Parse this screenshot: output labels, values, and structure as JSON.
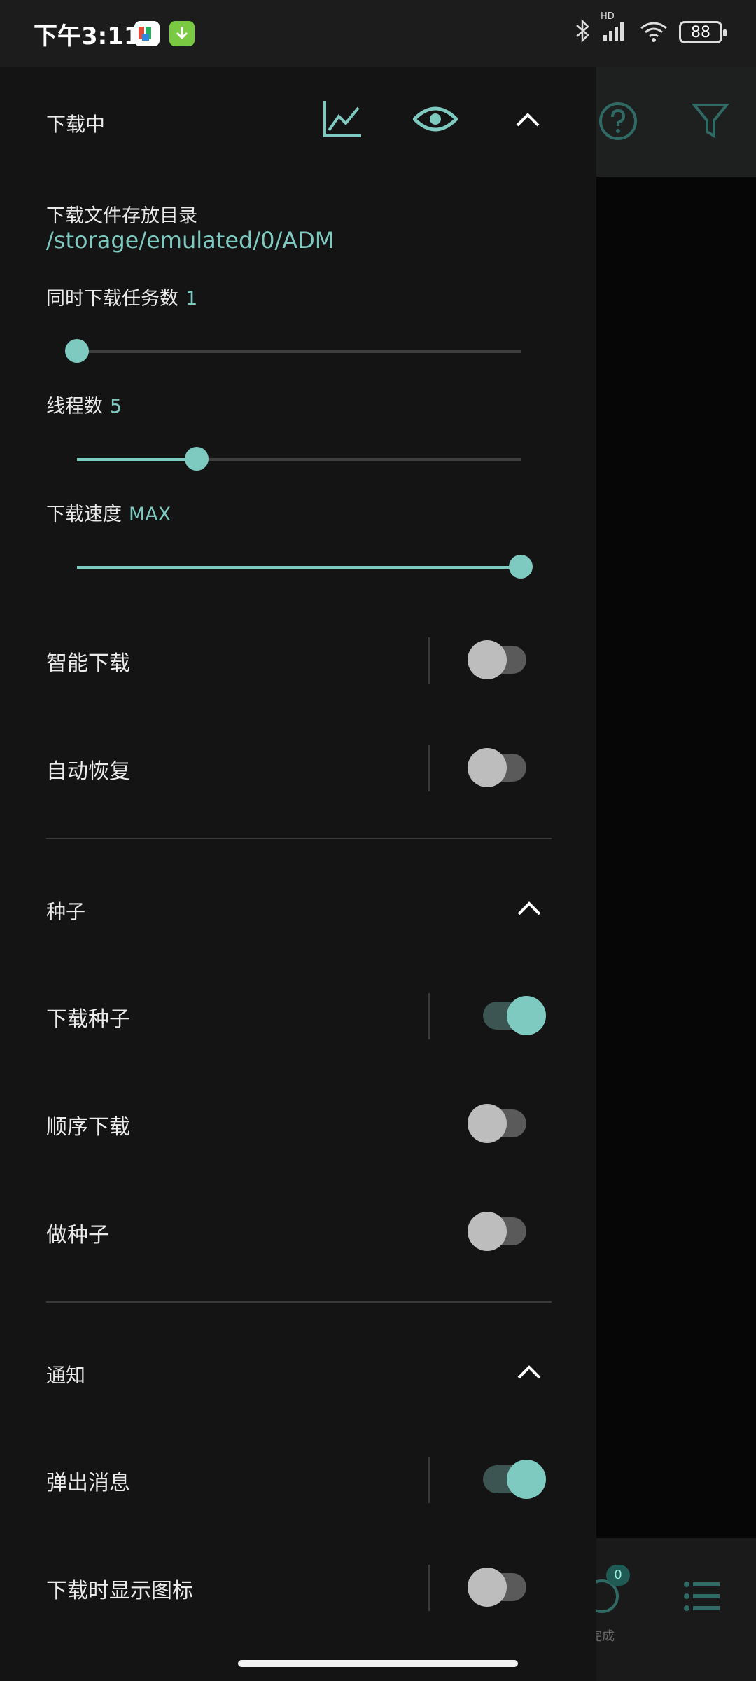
{
  "status_bar": {
    "time": "下午3:11",
    "icons": [
      "bluetooth-icon",
      "hd-signal-icon",
      "wifi-icon"
    ],
    "hd_label": "HD",
    "battery": "88"
  },
  "drawer": {
    "header": {
      "title": "下载中",
      "actions": [
        "chart-icon",
        "eye-icon",
        "chevron-up-icon"
      ]
    },
    "download_dir": {
      "label": "下载文件存放目录",
      "value": "/storage/emulated/0/ADM"
    },
    "concurrent_tasks": {
      "label": "同时下载任务数",
      "value": "1",
      "level": 0.0
    },
    "threads": {
      "label": "线程数",
      "value": "5",
      "level": 0.27
    },
    "speed": {
      "label": "下载速度",
      "value": "MAX",
      "level": 1.0
    },
    "toggles": [
      {
        "label": "智能下载",
        "on": false
      },
      {
        "label": "自动恢复",
        "on": false
      }
    ],
    "torrent_section": {
      "title": "种子",
      "items": [
        {
          "label": "下载种子",
          "on": true
        },
        {
          "label": "顺序下载",
          "on": false
        },
        {
          "label": "做种子",
          "on": false
        }
      ]
    },
    "notify_section": {
      "title": "通知",
      "items": [
        {
          "label": "弹出消息",
          "on": true
        },
        {
          "label": "下载时显示图标",
          "on": false
        }
      ]
    }
  },
  "background": {
    "toolbar_icons": [
      "help-icon",
      "filter-icon"
    ],
    "bottom_badge": "0",
    "bottom_label": "完成"
  },
  "colors": {
    "accent": "#7fcac0",
    "drawer_bg": "#141414",
    "text": "#eaeaea"
  }
}
